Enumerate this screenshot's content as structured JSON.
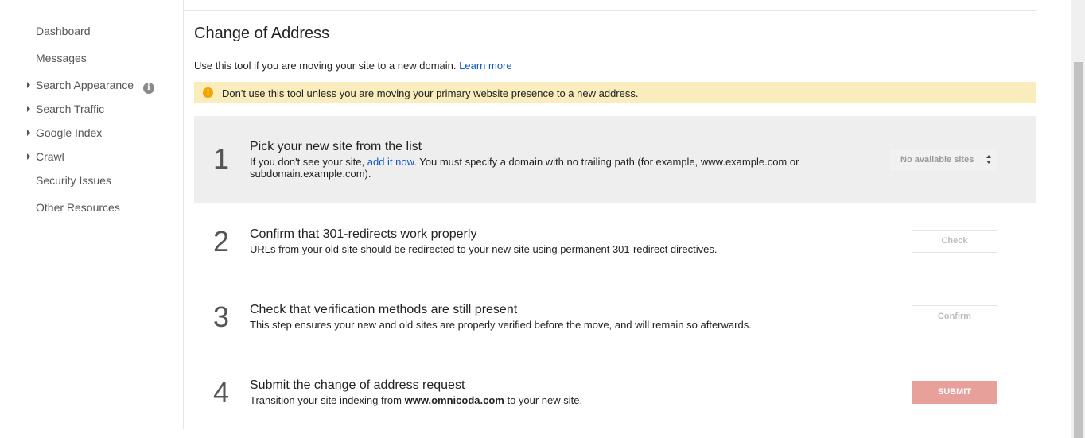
{
  "sidebar": {
    "items": [
      {
        "label": "Dashboard"
      },
      {
        "label": "Messages"
      },
      {
        "label": "Search Appearance"
      },
      {
        "label": "Search Traffic"
      },
      {
        "label": "Google Index"
      },
      {
        "label": "Crawl"
      },
      {
        "label": "Security Issues"
      },
      {
        "label": "Other Resources"
      }
    ],
    "info_icon_glyph": "i"
  },
  "main": {
    "title": "Change of Address",
    "intro_text": "Use this tool if you are moving your site to a new domain.",
    "learn_more": "Learn more",
    "warning": {
      "icon_glyph": "!",
      "text": "Don't use this tool unless you are moving your primary website presence to a new address.",
      "background": "#f9edbe",
      "icon_color": "#f4a200"
    },
    "steps": [
      {
        "number": "1",
        "title": "Pick your new site from the list",
        "desc_before": "If you don't see your site,",
        "desc_link": "add it now.",
        "desc_after": "You must specify a domain with no trailing path (for example, www.example.com or subdomain.example.com).",
        "select_value": "No available sites"
      },
      {
        "number": "2",
        "title": "Confirm that 301-redirects work properly",
        "desc": "URLs from your old site should be redirected to your new site using permanent 301-redirect directives.",
        "button": "Check"
      },
      {
        "number": "3",
        "title": "Check that verification methods are still present",
        "desc": "This step ensures your new and old sites are properly verified before the move, and will remain so afterwards.",
        "button": "Confirm"
      },
      {
        "number": "4",
        "title": "Submit the change of address request",
        "desc_before": "Transition your site indexing from",
        "desc_bold": "www.omnicoda.com",
        "desc_after": "to your new site.",
        "button": "SUBMIT"
      }
    ]
  },
  "colors": {
    "link": "#1155cc",
    "submit_button": "#e8a09a",
    "active_step_bg": "#eeeeee"
  }
}
